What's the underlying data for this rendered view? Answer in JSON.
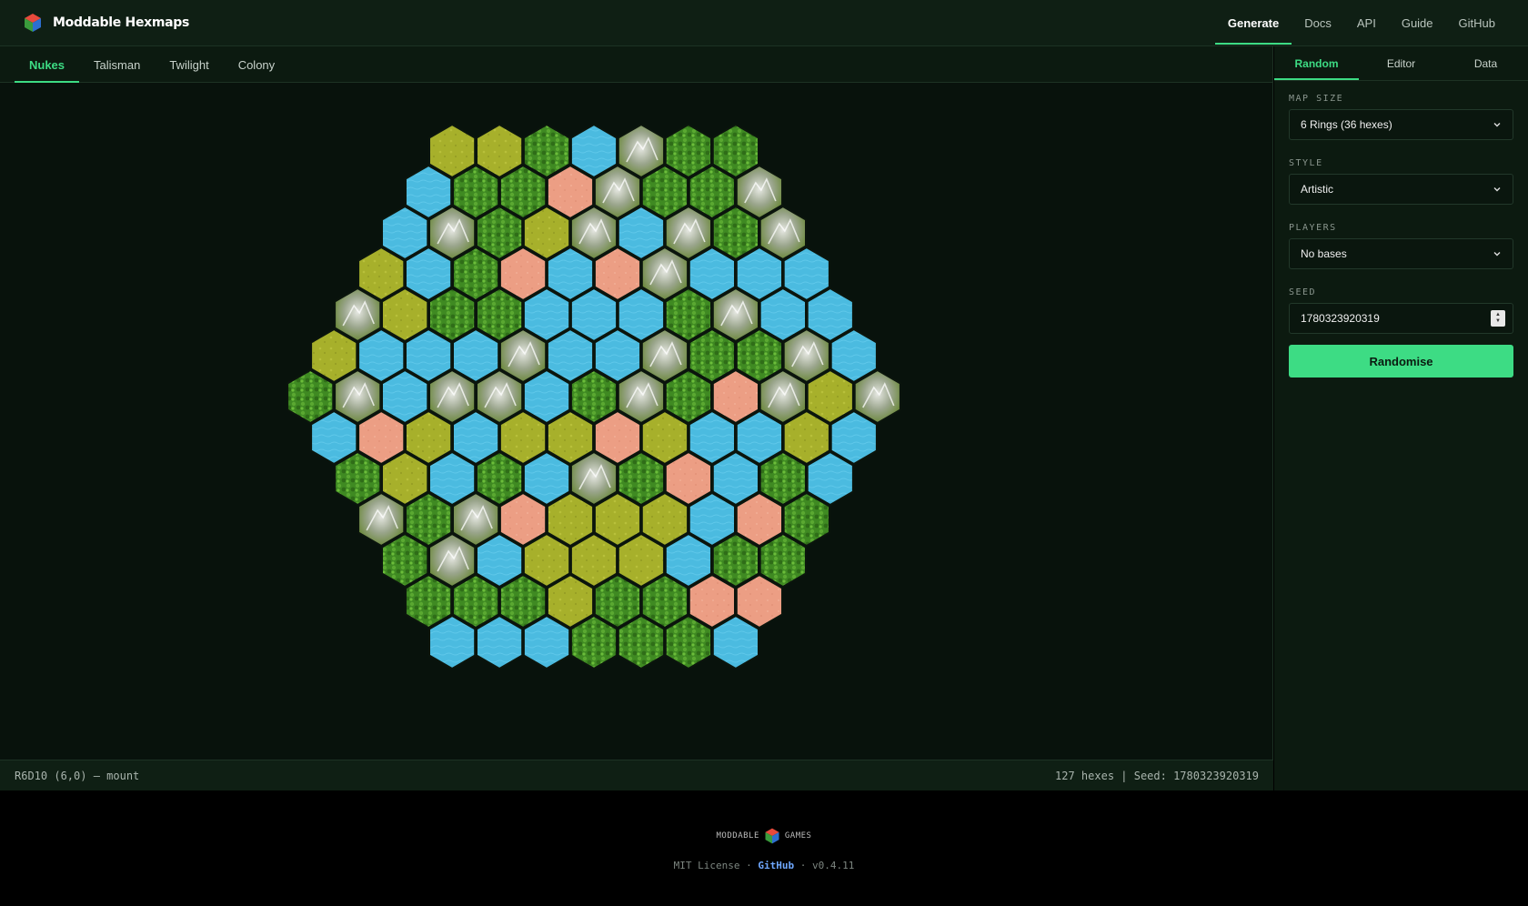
{
  "header": {
    "app_name": "Moddable Hexmaps",
    "nav": [
      {
        "label": "Generate",
        "active": true
      },
      {
        "label": "Docs",
        "active": false
      },
      {
        "label": "API",
        "active": false
      },
      {
        "label": "Guide",
        "active": false
      },
      {
        "label": "GitHub",
        "active": false
      }
    ]
  },
  "map_tabs": [
    {
      "label": "Nukes",
      "active": true
    },
    {
      "label": "Talisman",
      "active": false
    },
    {
      "label": "Twilight",
      "active": false
    },
    {
      "label": "Colony",
      "active": false
    }
  ],
  "side_tabs": [
    {
      "label": "Random",
      "active": true
    },
    {
      "label": "Editor",
      "active": false
    },
    {
      "label": "Data",
      "active": false
    }
  ],
  "form": {
    "map_size_label": "MAP SIZE",
    "map_size_value": "6 Rings (36 hexes)",
    "style_label": "STYLE",
    "style_value": "Artistic",
    "players_label": "PLAYERS",
    "players_value": "No bases",
    "seed_label": "SEED",
    "seed_value": "1780323920319",
    "randomise_label": "Randomise"
  },
  "status": {
    "left": "R6D10 (6,0) — mount",
    "right": "127 hexes | Seed: 1780323920319"
  },
  "footer": {
    "logo_left": "MODDABLE",
    "logo_right": "GAMES",
    "license": "MIT License",
    "sep1": "·",
    "github": "GitHub",
    "sep2": "·",
    "version": "v0.4.11"
  },
  "colors": {
    "accent": "#3ddc84",
    "water": "#4bbbe0",
    "grass": "#a7b02b",
    "forest": "#3f8a22",
    "mount": "#9aa58c",
    "desert": "#ec9e84"
  },
  "hexmap": {
    "legend": {
      "W": "water",
      "G": "grass",
      "F": "forest",
      "M": "mount",
      "D": "desert"
    },
    "rows": [
      "GGFWMFF",
      "WFFDMFFM",
      "WMFGMWMFM",
      "GWFDWDMWWW",
      "MGFFWWWFMWW",
      "GWWWMWWMFFMW",
      "FMWMMWFMFDMGM",
      "WDGWGGDGWWGW",
      "FGWFWMFDWFW",
      "MFMDGGGWDF",
      "FMWGGGWFF",
      "FFFGFFDD",
      "WWWFFFW"
    ]
  }
}
